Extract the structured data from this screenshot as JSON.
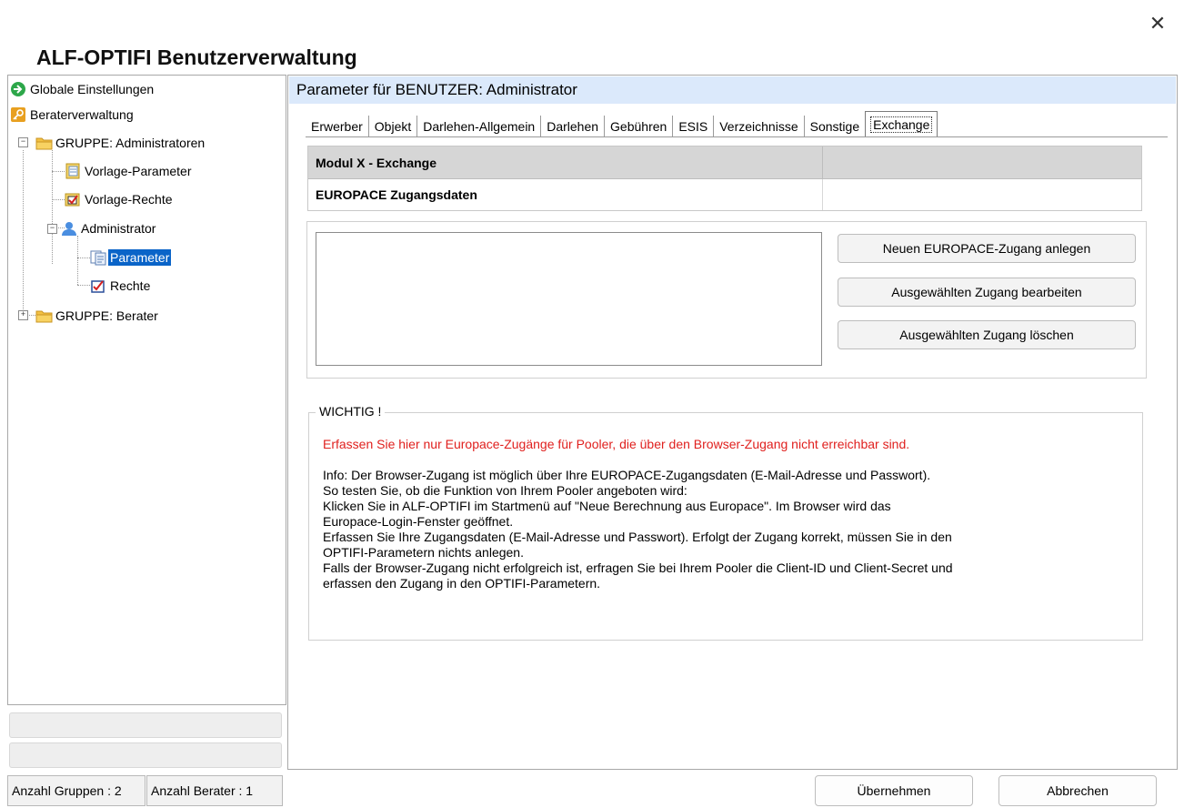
{
  "window": {
    "title": "ALF-OPTIFI Benutzerverwaltung",
    "close_glyph": "✕"
  },
  "tree": {
    "items": [
      {
        "label": "Globale Einstellungen",
        "icon": "globe-arrow-icon"
      },
      {
        "label": "Beraterverwaltung",
        "icon": "key-icon"
      },
      {
        "label": "GRUPPE: Administratoren",
        "icon": "group-folder-icon",
        "expander": "−"
      },
      {
        "label": "Vorlage-Parameter",
        "icon": "template-parameter-icon"
      },
      {
        "label": "Vorlage-Rechte",
        "icon": "template-rights-icon"
      },
      {
        "label": "Administrator",
        "icon": "user-icon",
        "expander": "−"
      },
      {
        "label": "Parameter",
        "icon": "parameter-icon",
        "selected": true
      },
      {
        "label": "Rechte",
        "icon": "rights-checkbox-icon"
      },
      {
        "label": "GRUPPE: Berater",
        "icon": "group-folder-icon",
        "expander": "+"
      }
    ]
  },
  "status": {
    "groups": "Anzahl Gruppen : 2",
    "advisors": "Anzahl Berater : 1"
  },
  "panel": {
    "header": "Parameter für BENUTZER: Administrator",
    "tabs": [
      "Erwerber",
      "Objekt",
      "Darlehen-Allgemein",
      "Darlehen",
      "Gebühren",
      "ESIS",
      "Verzeichnisse",
      "Sonstige",
      "Exchange"
    ],
    "active_tab": "Exchange",
    "grid": {
      "row1": "Modul X - Exchange",
      "row2": "EUROPACE Zugangsdaten"
    },
    "buttons": {
      "new": "Neuen EUROPACE-Zugang anlegen",
      "edit": "Ausgewählten Zugang bearbeiten",
      "delete": "Ausgewählten Zugang löschen"
    },
    "wichtig": {
      "legend": "WICHTIG !",
      "warning": "Erfassen Sie hier nur Europace-Zugänge für Pooler, die über den Browser-Zugang nicht erreichbar sind.",
      "lines": [
        "Info: Der Browser-Zugang ist möglich über Ihre EUROPACE-Zugangsdaten (E-Mail-Adresse und Passwort).",
        "So testen Sie, ob die Funktion von Ihrem Pooler angeboten wird:",
        "Klicken Sie in ALF-OPTIFI im Startmenü auf \"Neue Berechnung aus Europace\". Im Browser wird das",
        "Europace-Login-Fenster geöffnet.",
        "Erfassen Sie Ihre Zugangsdaten (E-Mail-Adresse und Passwort). Erfolgt der Zugang korrekt, müssen Sie in den",
        "OPTIFI-Parametern nichts anlegen.",
        "Falls der Browser-Zugang nicht erfolgreich ist, erfragen Sie bei Ihrem Pooler die Client-ID und Client-Secret und",
        "erfassen den Zugang in den OPTIFI-Parametern."
      ]
    }
  },
  "footer": {
    "apply": "Übernehmen",
    "cancel": "Abbrechen"
  },
  "colors": {
    "selection": "#0a64c8",
    "header_bg": "#dbe9fb",
    "warning": "#e0201e",
    "grid_header": "#d6d6d6"
  }
}
